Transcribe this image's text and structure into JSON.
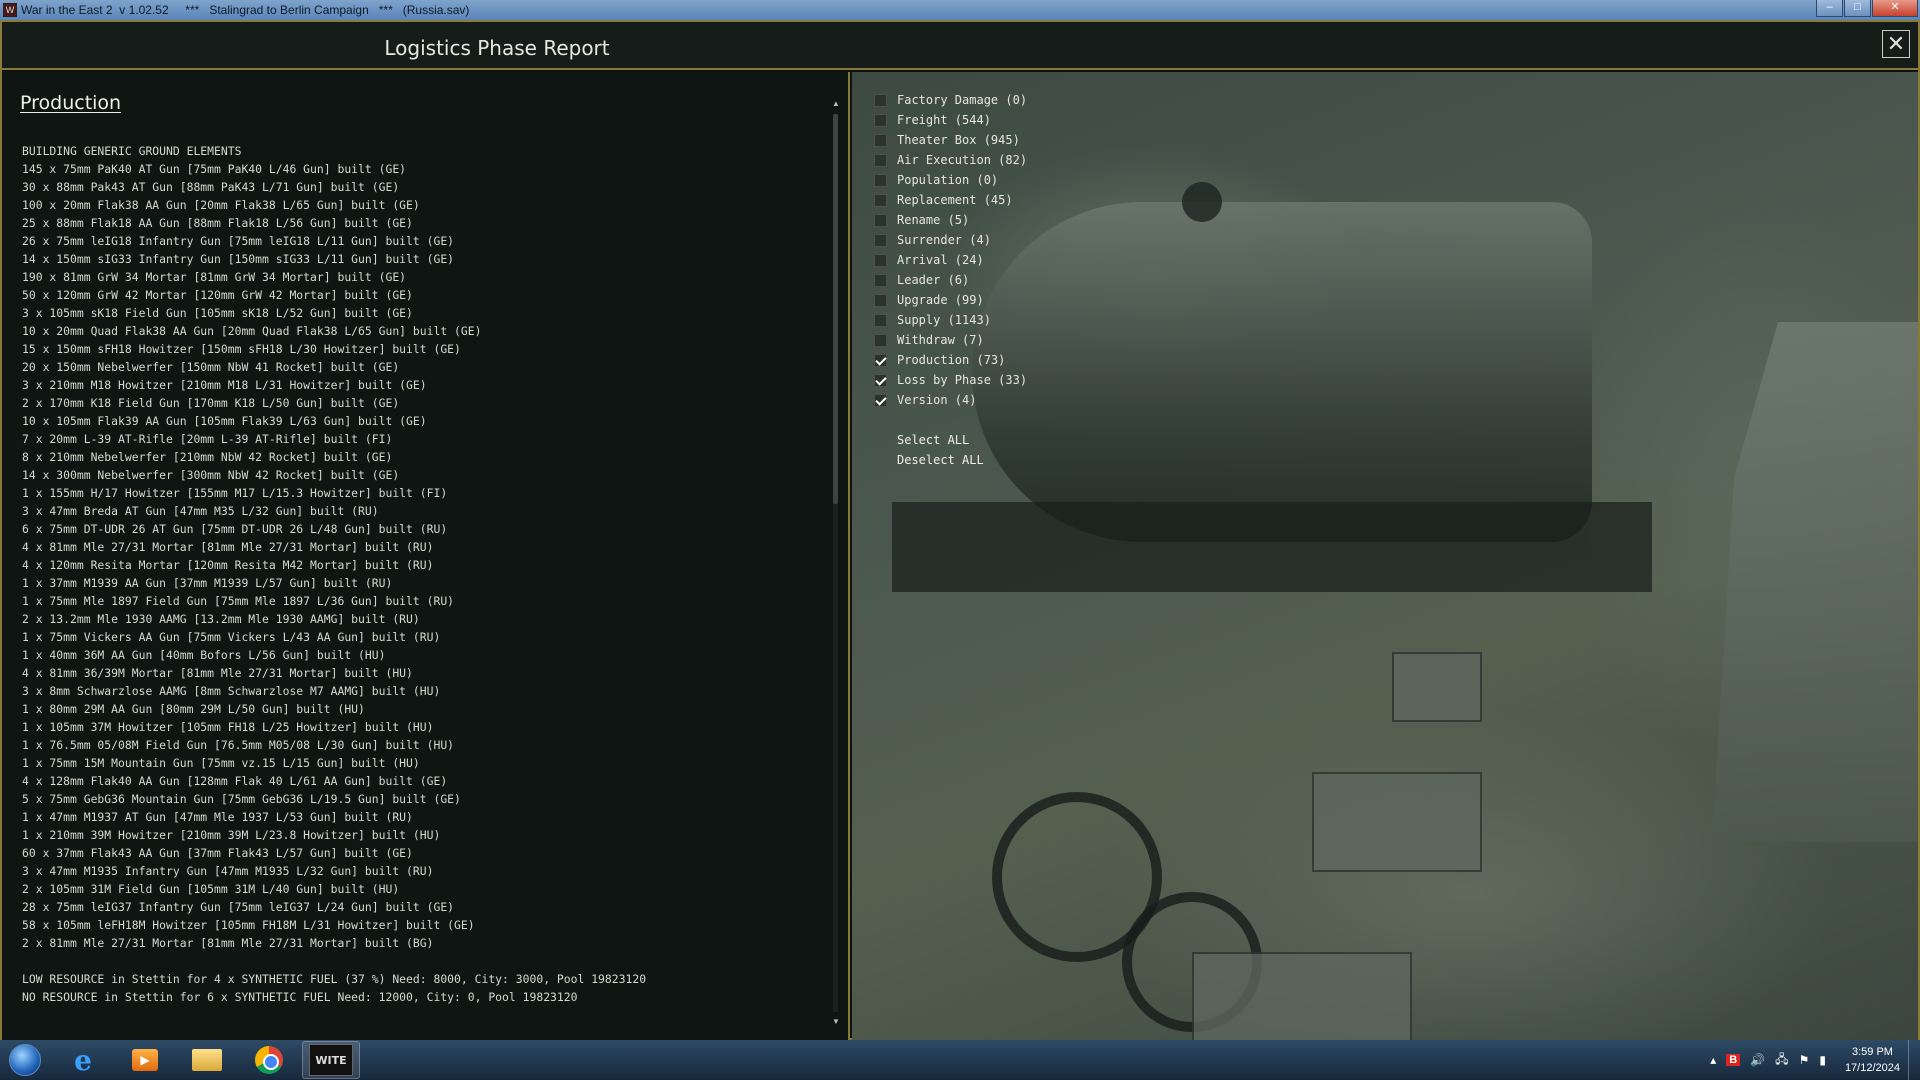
{
  "window": {
    "title": "War in the East 2  v 1.02.52     ***   Stalingrad to Berlin Campaign   ***   (Russia.sav)",
    "minimize": "–",
    "maximize": "□",
    "close": "✕"
  },
  "report": {
    "title": "Logistics Phase Report",
    "close_label": "✕",
    "section_title": "Production",
    "lines": [
      "BUILDING GENERIC GROUND ELEMENTS",
      "145 x 75mm PaK40 AT Gun [75mm PaK40 L/46 Gun] built (GE)",
      "30 x 88mm Pak43 AT Gun [88mm PaK43 L/71 Gun] built (GE)",
      "100 x 20mm Flak38 AA Gun [20mm Flak38 L/65 Gun] built (GE)",
      "25 x 88mm Flak18 AA Gun [88mm Flak18 L/56 Gun] built (GE)",
      "26 x 75mm leIG18 Infantry Gun [75mm leIG18 L/11 Gun] built (GE)",
      "14 x 150mm sIG33 Infantry Gun [150mm sIG33 L/11 Gun] built (GE)",
      "190 x 81mm GrW 34 Mortar [81mm GrW 34 Mortar] built (GE)",
      "50 x 120mm GrW 42 Mortar [120mm GrW 42 Mortar] built (GE)",
      "3 x 105mm sK18 Field Gun [105mm sK18 L/52 Gun] built (GE)",
      "10 x 20mm Quad Flak38 AA Gun [20mm Quad Flak38 L/65 Gun] built (GE)",
      "15 x 150mm sFH18 Howitzer [150mm sFH18 L/30 Howitzer] built (GE)",
      "20 x 150mm Nebelwerfer [150mm NbW 41 Rocket] built (GE)",
      "3 x 210mm M18 Howitzer [210mm M18 L/31 Howitzer] built (GE)",
      "2 x 170mm K18 Field Gun [170mm K18 L/50 Gun] built (GE)",
      "10 x 105mm Flak39 AA Gun [105mm Flak39 L/63 Gun] built (GE)",
      "7 x 20mm L-39 AT-Rifle [20mm L-39 AT-Rifle] built (FI)",
      "8 x 210mm Nebelwerfer [210mm NbW 42 Rocket] built (GE)",
      "14 x 300mm Nebelwerfer [300mm NbW 42 Rocket] built (GE)",
      "1 x 155mm H/17 Howitzer [155mm M17 L/15.3 Howitzer] built (FI)",
      "3 x 47mm Breda AT Gun [47mm M35 L/32 Gun] built (RU)",
      "6 x 75mm DT-UDR 26 AT Gun [75mm DT-UDR 26 L/48 Gun] built (RU)",
      "4 x 81mm Mle 27/31 Mortar [81mm Mle 27/31 Mortar] built (RU)",
      "4 x 120mm Resita Mortar [120mm Resita M42 Mortar] built (RU)",
      "1 x 37mm M1939 AA Gun [37mm M1939 L/57 Gun] built (RU)",
      "1 x 75mm Mle 1897 Field Gun [75mm Mle 1897 L/36 Gun] built (RU)",
      "2 x 13.2mm Mle 1930 AAMG [13.2mm Mle 1930 AAMG] built (RU)",
      "1 x 75mm Vickers AA Gun [75mm Vickers L/43 AA Gun] built (RU)",
      "1 x 40mm 36M AA Gun [40mm Bofors L/56 Gun] built (HU)",
      "4 x 81mm 36/39M Mortar [81mm Mle 27/31 Mortar] built (HU)",
      "3 x 8mm Schwarzlose AAMG [8mm Schwarzlose M7 AAMG] built (HU)",
      "1 x 80mm 29M AA Gun [80mm 29M L/50 Gun] built (HU)",
      "1 x 105mm 37M Howitzer [105mm FH18 L/25 Howitzer] built (HU)",
      "1 x 76.5mm 05/08M Field Gun [76.5mm M05/08 L/30 Gun] built (HU)",
      "1 x 75mm 15M Mountain Gun [75mm vz.15 L/15 Gun] built (HU)",
      "4 x 128mm Flak40 AA Gun [128mm Flak 40 L/61 AA Gun] built (GE)",
      "5 x 75mm GebG36 Mountain Gun [75mm GebG36 L/19.5 Gun] built (GE)",
      "1 x 47mm M1937 AT Gun [47mm Mle 1937 L/53 Gun] built (RU)",
      "1 x 210mm 39M Howitzer [210mm 39M L/23.8 Howitzer] built (HU)",
      "60 x 37mm Flak43 AA Gun [37mm Flak43 L/57 Gun] built (GE)",
      "3 x 47mm M1935 Infantry Gun [47mm M1935 L/32 Gun] built (RU)",
      "2 x 105mm 31M Field Gun [105mm 31M L/40 Gun] built (HU)",
      "28 x 75mm leIG37 Infantry Gun [75mm leIG37 L/24 Gun] built (GE)",
      "58 x 105mm leFH18M Howitzer [105mm FH18M L/31 Howitzer] built (GE)",
      "2 x 81mm Mle 27/31 Mortar [81mm Mle 27/31 Mortar] built (BG)"
    ],
    "resource_lines": [
      "LOW RESOURCE in Stettin for 4 x SYNTHETIC FUEL (37 %) Need: 8000, City: 3000, Pool 19823120",
      "NO RESOURCE in Stettin for 6 x SYNTHETIC FUEL Need: 12000, City: 0, Pool 19823120"
    ],
    "scroll_up": "▲",
    "scroll_down": "▼"
  },
  "filters": [
    {
      "label": "Factory Damage  (0)",
      "checked": false
    },
    {
      "label": "Freight  (544)",
      "checked": false
    },
    {
      "label": "Theater Box  (945)",
      "checked": false
    },
    {
      "label": "Air Execution  (82)",
      "checked": false
    },
    {
      "label": "Population  (0)",
      "checked": false
    },
    {
      "label": "Replacement  (45)",
      "checked": false
    },
    {
      "label": "Rename  (5)",
      "checked": false
    },
    {
      "label": "Surrender  (4)",
      "checked": false
    },
    {
      "label": "Arrival  (24)",
      "checked": false
    },
    {
      "label": "Leader  (6)",
      "checked": false
    },
    {
      "label": "Upgrade  (99)",
      "checked": false
    },
    {
      "label": "Supply  (1143)",
      "checked": false
    },
    {
      "label": "Withdraw  (7)",
      "checked": false
    },
    {
      "label": "Production  (73)",
      "checked": true
    },
    {
      "label": "Loss by Phase  (33)",
      "checked": true
    },
    {
      "label": "Version  (4)",
      "checked": true
    }
  ],
  "actions": {
    "select_all": "Select ALL",
    "deselect_all": "Deselect ALL"
  },
  "taskbar": {
    "wite_label": "WITE",
    "time": "3:59 PM",
    "date": "17/12/2024",
    "b_icon": "B"
  }
}
